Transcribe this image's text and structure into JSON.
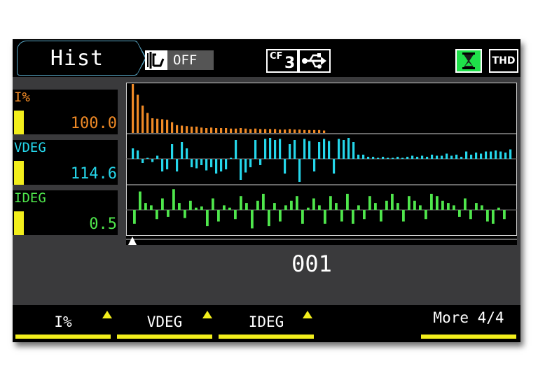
{
  "header": {
    "title": "Hist",
    "cursor_label": "OFF",
    "storage_badge": {
      "cf": "CF",
      "num": "3"
    },
    "thd_label": "THD",
    "icons": [
      "cursor-icon",
      "usb-icon",
      "hourglass-icon"
    ]
  },
  "channels": [
    {
      "name": "I%",
      "value": "100.0",
      "color": "#f08a26"
    },
    {
      "name": "VDEG",
      "value": "114.6",
      "color": "#25d6ea"
    },
    {
      "name": "IDEG",
      "value": "0.5",
      "color": "#4fe64c"
    }
  ],
  "cursor": {
    "value": "001"
  },
  "softkeys": [
    {
      "label": "I%"
    },
    {
      "label": "VDEG"
    },
    {
      "label": "IDEG"
    },
    {
      "label": "More 4/4"
    }
  ],
  "colors": {
    "accent": "#f2ee1c",
    "orange": "#f08a26",
    "cyan": "#25d6ea",
    "green": "#4fe64c",
    "bg": "#3a3a3c"
  },
  "chart_data": {
    "type": "bar",
    "x": {
      "range": [
        1,
        50
      ]
    },
    "series": [
      {
        "values": [
          100,
          78,
          56,
          41,
          30,
          29,
          28,
          27,
          22,
          16,
          15,
          14,
          13,
          13,
          11,
          10,
          11,
          10,
          10,
          10,
          9,
          9,
          10,
          9,
          8,
          9,
          8,
          8,
          8,
          8,
          7,
          7,
          8,
          7,
          7,
          6,
          6,
          6,
          6,
          5,
          0,
          0,
          0,
          0,
          0,
          0,
          0,
          0,
          0,
          0
        ]
      },
      {
        "values": [
          50,
          40,
          -20,
          5,
          -15,
          15,
          -60,
          -50,
          70,
          -60,
          80,
          50,
          -40,
          -45,
          -30,
          -55,
          -40,
          -70,
          -60,
          -50,
          5,
          90,
          -100,
          -65,
          -40,
          90,
          -30,
          95,
          100,
          90,
          95,
          -70,
          70,
          90,
          -110,
          95,
          85,
          -60,
          80,
          95,
          85,
          -70,
          95,
          90,
          100,
          80,
          20,
          20,
          10,
          10,
          5,
          10,
          5,
          5,
          10,
          5,
          10,
          15,
          10,
          15,
          10,
          20,
          15,
          15,
          25,
          15,
          20,
          10,
          35,
          20,
          30,
          25,
          35,
          35,
          40,
          35,
          30,
          45
        ]
      },
      {
        "values": [
          -60,
          80,
          30,
          20,
          -40,
          50,
          -30,
          90,
          30,
          -35,
          40,
          10,
          15,
          -70,
          50,
          -50,
          20,
          10,
          -40,
          60,
          30,
          -80,
          40,
          70,
          -70,
          30,
          -50,
          20,
          40,
          60,
          -60,
          10,
          50,
          20,
          -60,
          60,
          30,
          -50,
          70,
          -60,
          20,
          -40,
          60,
          30,
          -50,
          40,
          70,
          30,
          -50,
          60,
          40,
          20,
          -40,
          70,
          60,
          40,
          30,
          20,
          -30,
          50,
          -40,
          30,
          20,
          -50,
          -60,
          10,
          -40
        ]
      }
    ]
  }
}
